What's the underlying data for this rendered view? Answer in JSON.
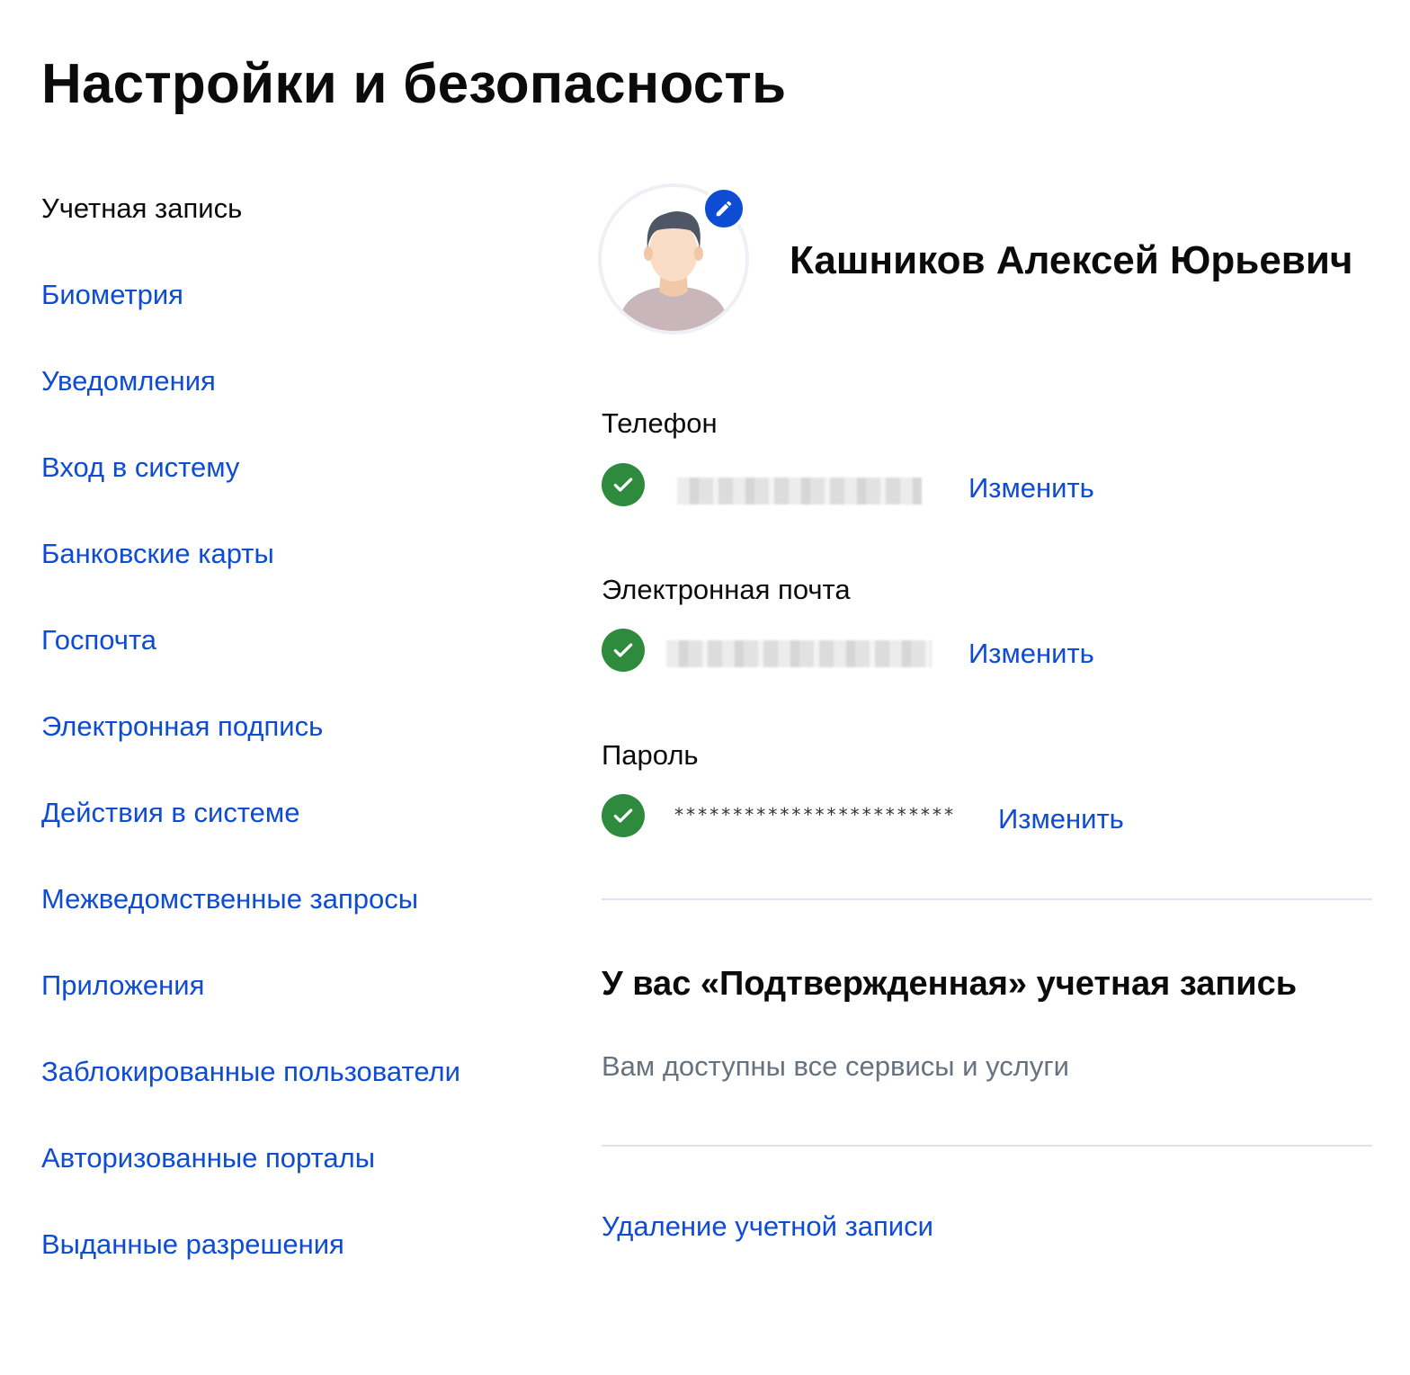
{
  "page": {
    "title": "Настройки и безопасность"
  },
  "sidebar": {
    "items": [
      {
        "label": "Учетная запись",
        "active": true
      },
      {
        "label": "Биометрия",
        "active": false
      },
      {
        "label": "Уведомления",
        "active": false
      },
      {
        "label": "Вход в систему",
        "active": false
      },
      {
        "label": "Банковские карты",
        "active": false
      },
      {
        "label": "Госпочта",
        "active": false
      },
      {
        "label": "Электронная подпись",
        "active": false
      },
      {
        "label": "Действия в системе",
        "active": false
      },
      {
        "label": "Межведомственные запросы",
        "active": false
      },
      {
        "label": "Приложения",
        "active": false
      },
      {
        "label": "Заблокированные пользователи",
        "active": false
      },
      {
        "label": "Авторизованные порталы",
        "active": false
      },
      {
        "label": "Выданные разрешения",
        "active": false
      }
    ]
  },
  "profile": {
    "name": "Кашников Алексей Юрьевич",
    "avatar_icon": "user-avatar-icon",
    "edit_icon": "pencil-icon"
  },
  "contacts": {
    "phone": {
      "label": "Телефон",
      "status_icon": "check-circle-icon",
      "value_hidden": true,
      "action": "Изменить"
    },
    "email": {
      "label": "Электронная почта",
      "status_icon": "check-circle-icon",
      "value_hidden": true,
      "action": "Изменить"
    },
    "password": {
      "label": "Пароль",
      "status_icon": "check-circle-icon",
      "mask": "************************",
      "action": "Изменить"
    }
  },
  "account_status": {
    "title": "У вас «Подтвержденная» учетная запись",
    "description": "Вам доступны все сервисы и услуги"
  },
  "delete_account": {
    "label": "Удаление учетной записи"
  },
  "colors": {
    "link": "#0d4cd3",
    "success": "#2e8b3d",
    "text": "#0b0b0b",
    "muted": "#66727f",
    "divider": "#dde3ec"
  }
}
